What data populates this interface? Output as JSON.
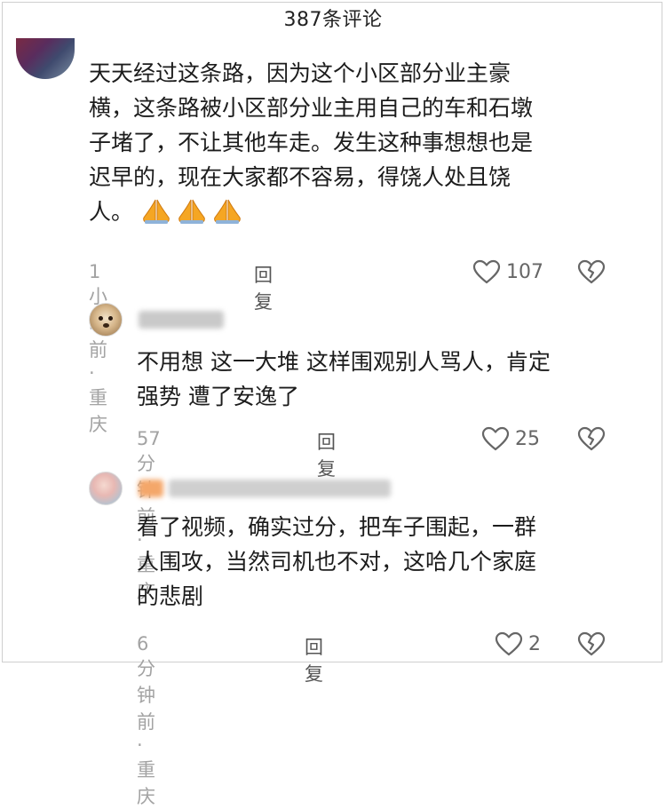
{
  "header": {
    "title": "387条评论"
  },
  "comments": [
    {
      "text_lines": [
        "天天经过这条路，因为这个小区部分业主豪",
        "横，这条路被小区部分业主用自己的车和石墩",
        "子堵了，不让其他车走。发生这种事想想也是",
        "迟早的，现在大家都不容易，得饶人处且饶",
        "人。"
      ],
      "meta": "1小时前 · 重庆",
      "reply": "回复",
      "likes": "107",
      "emoji_icon": "folded-hands-icon",
      "emoji_count": 3
    },
    {
      "text_lines": [
        "不用想 这一大堆 这样围观别人骂人，肯定",
        "强势 遭了安逸了"
      ],
      "meta": "57分钟前 · 重庆",
      "reply": "回复",
      "likes": "25"
    },
    {
      "text_lines": [
        "看了视频，确实过分，把车子围起，一群",
        "人围攻，当然司机也不对，这哈几个家庭",
        "的悲剧"
      ],
      "meta": "6分钟前 · 重庆",
      "reply": "回复",
      "likes": "2"
    }
  ],
  "colors": {
    "meta_gray": "#a3a3a3",
    "text": "#1c1c1c",
    "emoji_orange": "#f5a623"
  }
}
